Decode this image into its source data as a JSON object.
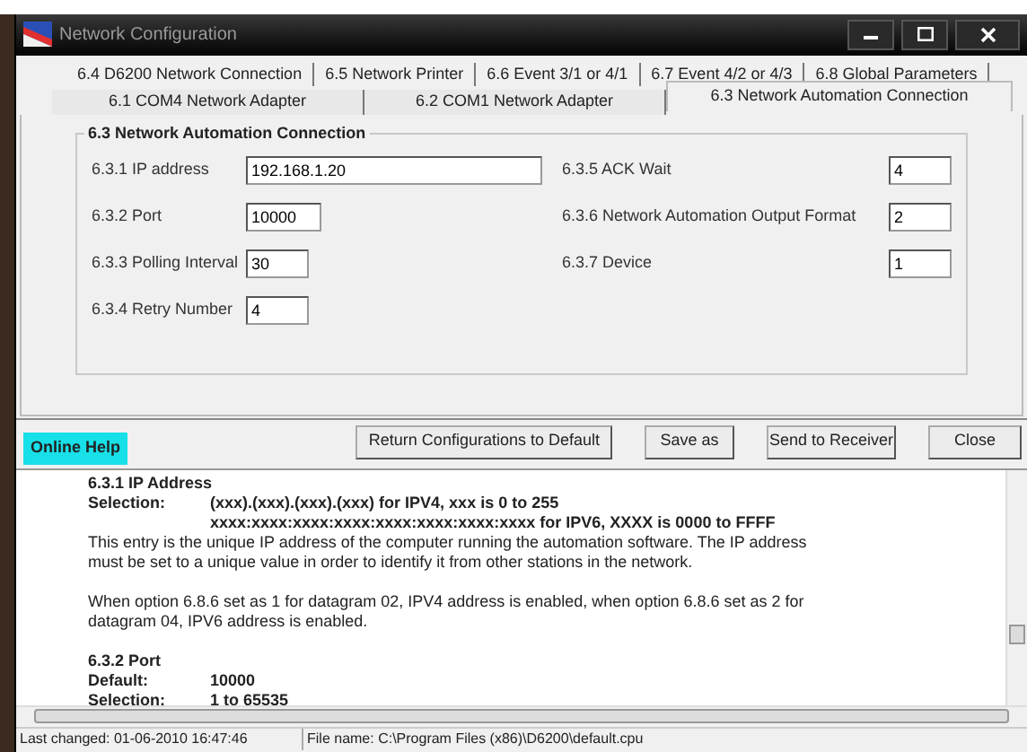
{
  "window": {
    "title": "Network Configuration"
  },
  "tab_rows": [
    [
      {
        "label": "6.4 D6200 Network Connection",
        "selected": false
      },
      {
        "label": "6.5 Network Printer",
        "selected": false
      },
      {
        "label": "6.6 Event 3/1 or 4/1",
        "selected": false
      },
      {
        "label": "6.7 Event 4/2 or 4/3",
        "selected": false
      },
      {
        "label": "6.8 Global Parameters",
        "selected": false
      }
    ],
    [
      {
        "label": "6.1 COM4 Network Adapter",
        "selected": false
      },
      {
        "label": "6.2 COM1 Network Adapter",
        "selected": false
      },
      {
        "label": "6.3  Network Automation Connection",
        "selected": true
      }
    ]
  ],
  "group": {
    "title": "6.3  Network Automation Connection",
    "left_fields": [
      {
        "label": "6.3.1 IP address",
        "value": "192.168.1.20"
      },
      {
        "label": "6.3.2 Port",
        "value": "10000"
      },
      {
        "label": "6.3.3 Polling Interval",
        "value": "30"
      },
      {
        "label": "6.3.4 Retry Number",
        "value": "4"
      }
    ],
    "right_fields": [
      {
        "label": "6.3.5 ACK Wait",
        "value": "4"
      },
      {
        "label": "6.3.6  Network Automation Output Format",
        "value": "2"
      },
      {
        "label": "6.3.7 Device",
        "value": "1"
      }
    ]
  },
  "online_help_label": "Online Help",
  "buttons": [
    "Return Configurations to Default",
    "Save as",
    "Send to Receiver",
    "Close"
  ],
  "help": [
    {
      "kind": "heading",
      "text": "6.3.1 IP Address"
    },
    {
      "kind": "field",
      "label": "Selection:",
      "values": [
        "(xxx).(xxx).(xxx).(xxx) for IPV4, xxx is 0 to 255",
        "xxxx:xxxx:xxxx:xxxx:xxxx:xxxx:xxxx:xxxx for IPV6, XXXX is 0000 to FFFF"
      ]
    },
    {
      "kind": "paragraph",
      "text": "This entry is the unique IP address of the computer running the automation software. The IP address must be set to a unique value in order to identify it from other stations in the network."
    },
    {
      "kind": "paragraph",
      "text": "When option 6.8.6 set as 1 for datagram 02, IPV4 address is enabled, when option 6.8.6 set as 2 for datagram 04, IPV6 address is enabled."
    },
    {
      "kind": "heading",
      "text": "6.3.2 Port"
    },
    {
      "kind": "field",
      "label": "Default:",
      "values": [
        "10000"
      ]
    },
    {
      "kind": "field",
      "label": "Selection:",
      "values": [
        "1 to 65535"
      ]
    }
  ],
  "status_bar": [
    "Last changed: 01-06-2010 16:47:46",
    "File name: C:\\Program Files (x86)\\D6200\\default.cpu"
  ]
}
